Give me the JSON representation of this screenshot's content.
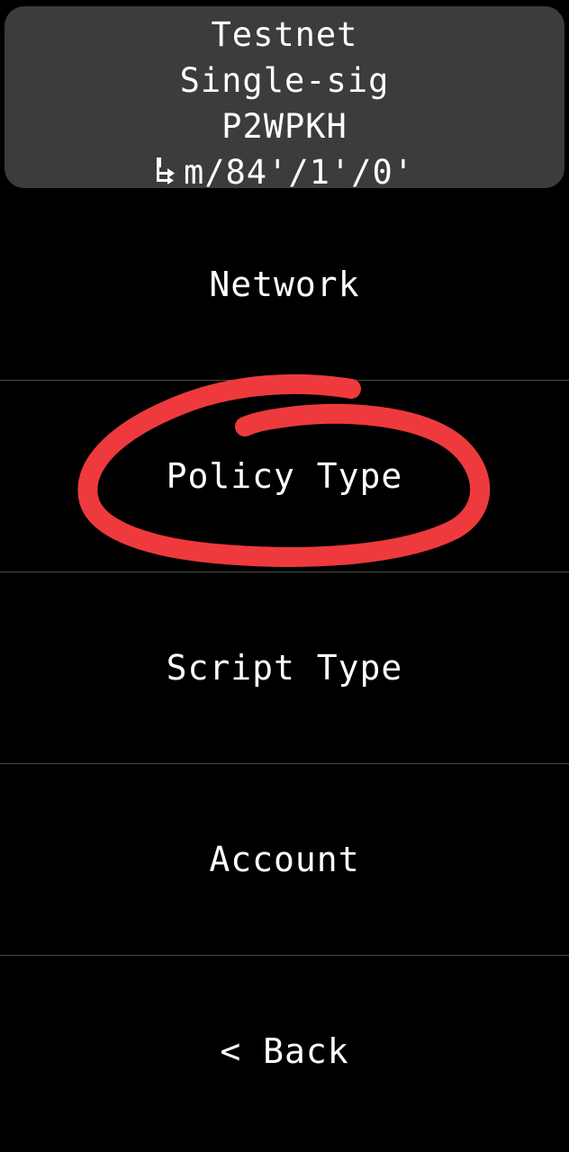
{
  "header": {
    "network": "Testnet",
    "policy": "Single-sig",
    "script": "P2WPKH",
    "derivation_path": "m/84'/1'/0'",
    "derivation_icon": "derivation-path-icon"
  },
  "menu": {
    "items": [
      {
        "label": "Network"
      },
      {
        "label": "Policy Type"
      },
      {
        "label": "Script Type"
      },
      {
        "label": "Account"
      },
      {
        "label": "< Back"
      }
    ]
  },
  "colors": {
    "background": "#000000",
    "header_background": "#3c3c3c",
    "text": "#ffffff",
    "divider": "#4a4a4a",
    "annotation_circle": "#ee3a3d"
  }
}
